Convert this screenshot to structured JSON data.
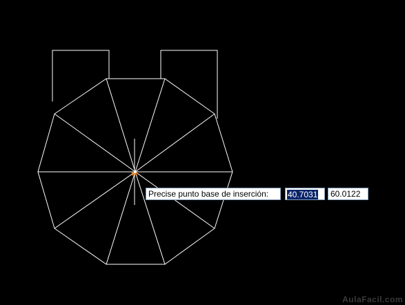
{
  "drawing": {
    "background": "#000000",
    "line_color": "#ffffff",
    "marker_color": "#ff8000",
    "cursor_color": "#ffffff"
  },
  "prompt": {
    "label": "Precise punto base de inserción:",
    "x_value": "40.7031",
    "y_value": "60.0122",
    "selection_color": "#0a246a"
  },
  "watermark": "AulaFacil.com"
}
